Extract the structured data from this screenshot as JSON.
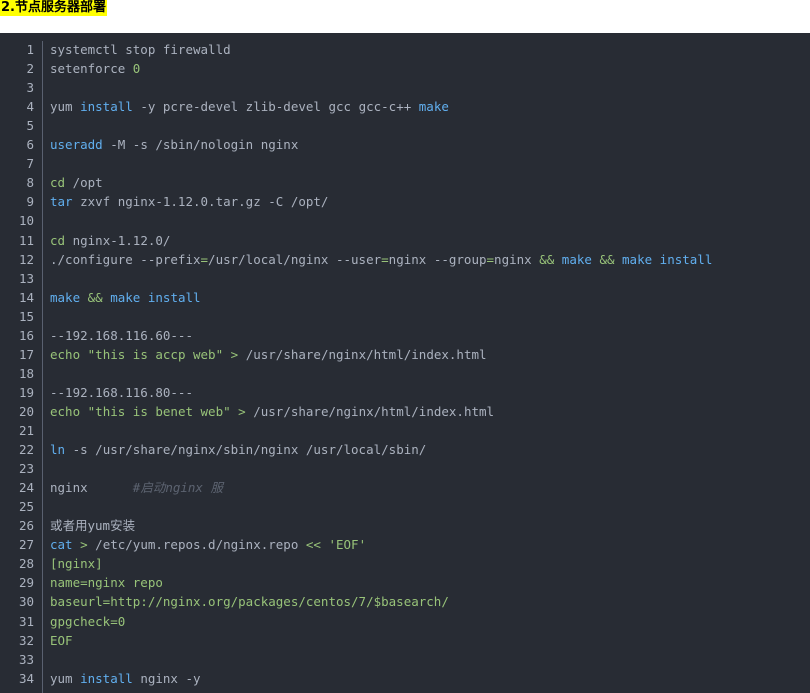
{
  "heading": "2.节点服务器部署",
  "lines": [
    {
      "n": "1",
      "tokens": [
        {
          "t": "systemctl stop firewalld",
          "c": "plain"
        }
      ]
    },
    {
      "n": "2",
      "tokens": [
        {
          "t": "setenforce ",
          "c": "plain"
        },
        {
          "t": "0",
          "c": "num"
        }
      ]
    },
    {
      "n": "3",
      "tokens": []
    },
    {
      "n": "4",
      "tokens": [
        {
          "t": "yum ",
          "c": "plain"
        },
        {
          "t": "install",
          "c": "kw"
        },
        {
          "t": " -y pcre-devel zlib-devel gcc gcc-c++ ",
          "c": "plain"
        },
        {
          "t": "make",
          "c": "kw"
        }
      ]
    },
    {
      "n": "5",
      "tokens": []
    },
    {
      "n": "6",
      "tokens": [
        {
          "t": "useradd",
          "c": "kw"
        },
        {
          "t": " -M -s /sbin/nologin nginx",
          "c": "plain"
        }
      ]
    },
    {
      "n": "7",
      "tokens": []
    },
    {
      "n": "8",
      "tokens": [
        {
          "t": "cd",
          "c": "green"
        },
        {
          "t": " /opt",
          "c": "plain"
        }
      ]
    },
    {
      "n": "9",
      "tokens": [
        {
          "t": "tar",
          "c": "kw"
        },
        {
          "t": " zxvf nginx-1.12.0.tar.gz -C /opt/",
          "c": "plain"
        }
      ]
    },
    {
      "n": "10",
      "tokens": []
    },
    {
      "n": "11",
      "tokens": [
        {
          "t": "cd",
          "c": "green"
        },
        {
          "t": " nginx-1.12.0/",
          "c": "plain"
        }
      ]
    },
    {
      "n": "12",
      "tokens": [
        {
          "t": "./configure --prefix",
          "c": "plain"
        },
        {
          "t": "=",
          "c": "op"
        },
        {
          "t": "/usr/local/nginx --user",
          "c": "plain"
        },
        {
          "t": "=",
          "c": "op"
        },
        {
          "t": "nginx --group",
          "c": "plain"
        },
        {
          "t": "=",
          "c": "op"
        },
        {
          "t": "nginx ",
          "c": "plain"
        },
        {
          "t": "&&",
          "c": "op"
        },
        {
          "t": " ",
          "c": "plain"
        },
        {
          "t": "make",
          "c": "kw"
        },
        {
          "t": " ",
          "c": "plain"
        },
        {
          "t": "&&",
          "c": "op"
        },
        {
          "t": " ",
          "c": "plain"
        },
        {
          "t": "make",
          "c": "kw"
        },
        {
          "t": " ",
          "c": "plain"
        },
        {
          "t": "install",
          "c": "kw"
        }
      ]
    },
    {
      "n": "13",
      "tokens": []
    },
    {
      "n": "14",
      "tokens": [
        {
          "t": "make",
          "c": "kw"
        },
        {
          "t": " ",
          "c": "plain"
        },
        {
          "t": "&&",
          "c": "op"
        },
        {
          "t": " ",
          "c": "plain"
        },
        {
          "t": "make",
          "c": "kw"
        },
        {
          "t": " ",
          "c": "plain"
        },
        {
          "t": "install",
          "c": "kw"
        }
      ]
    },
    {
      "n": "15",
      "tokens": []
    },
    {
      "n": "16",
      "tokens": [
        {
          "t": "--192.168.116.60---",
          "c": "plain"
        }
      ]
    },
    {
      "n": "17",
      "tokens": [
        {
          "t": "echo",
          "c": "green"
        },
        {
          "t": " ",
          "c": "plain"
        },
        {
          "t": "\"this is accp web\"",
          "c": "str"
        },
        {
          "t": " ",
          "c": "plain"
        },
        {
          "t": ">",
          "c": "op"
        },
        {
          "t": " /usr/share/nginx/html/index.html",
          "c": "plain"
        }
      ]
    },
    {
      "n": "18",
      "tokens": []
    },
    {
      "n": "19",
      "tokens": [
        {
          "t": "--192.168.116.80---",
          "c": "plain"
        }
      ]
    },
    {
      "n": "20",
      "tokens": [
        {
          "t": "echo",
          "c": "green"
        },
        {
          "t": " ",
          "c": "plain"
        },
        {
          "t": "\"this is benet web\"",
          "c": "str"
        },
        {
          "t": " ",
          "c": "plain"
        },
        {
          "t": ">",
          "c": "op"
        },
        {
          "t": " /usr/share/nginx/html/index.html",
          "c": "plain"
        }
      ]
    },
    {
      "n": "21",
      "tokens": []
    },
    {
      "n": "22",
      "tokens": [
        {
          "t": "ln",
          "c": "kw"
        },
        {
          "t": " -s /usr/share/nginx/sbin/nginx /usr/local/sbin/",
          "c": "plain"
        }
      ]
    },
    {
      "n": "23",
      "tokens": []
    },
    {
      "n": "24",
      "tokens": [
        {
          "t": "nginx      ",
          "c": "plain"
        },
        {
          "t": "#启动nginx 服",
          "c": "comment"
        }
      ]
    },
    {
      "n": "25",
      "tokens": []
    },
    {
      "n": "26",
      "tokens": [
        {
          "t": "或者用yum安装",
          "c": "plain"
        }
      ]
    },
    {
      "n": "27",
      "tokens": [
        {
          "t": "cat",
          "c": "kw"
        },
        {
          "t": " ",
          "c": "plain"
        },
        {
          "t": ">",
          "c": "op"
        },
        {
          "t": " /etc/yum.repos.d/nginx.repo ",
          "c": "plain"
        },
        {
          "t": "<<",
          "c": "op"
        },
        {
          "t": " ",
          "c": "plain"
        },
        {
          "t": "'EOF'",
          "c": "str"
        }
      ]
    },
    {
      "n": "28",
      "tokens": [
        {
          "t": "[nginx]",
          "c": "str"
        }
      ]
    },
    {
      "n": "29",
      "tokens": [
        {
          "t": "name=nginx repo",
          "c": "str"
        }
      ]
    },
    {
      "n": "30",
      "tokens": [
        {
          "t": "baseurl=http://nginx.org/packages/centos/7/$basearch/",
          "c": "str"
        }
      ]
    },
    {
      "n": "31",
      "tokens": [
        {
          "t": "gpgcheck=0",
          "c": "str"
        }
      ]
    },
    {
      "n": "32",
      "tokens": [
        {
          "t": "EOF",
          "c": "str"
        }
      ]
    },
    {
      "n": "33",
      "tokens": []
    },
    {
      "n": "34",
      "tokens": [
        {
          "t": "yum ",
          "c": "plain"
        },
        {
          "t": "install",
          "c": "kw"
        },
        {
          "t": " nginx -y",
          "c": "plain"
        }
      ]
    }
  ]
}
